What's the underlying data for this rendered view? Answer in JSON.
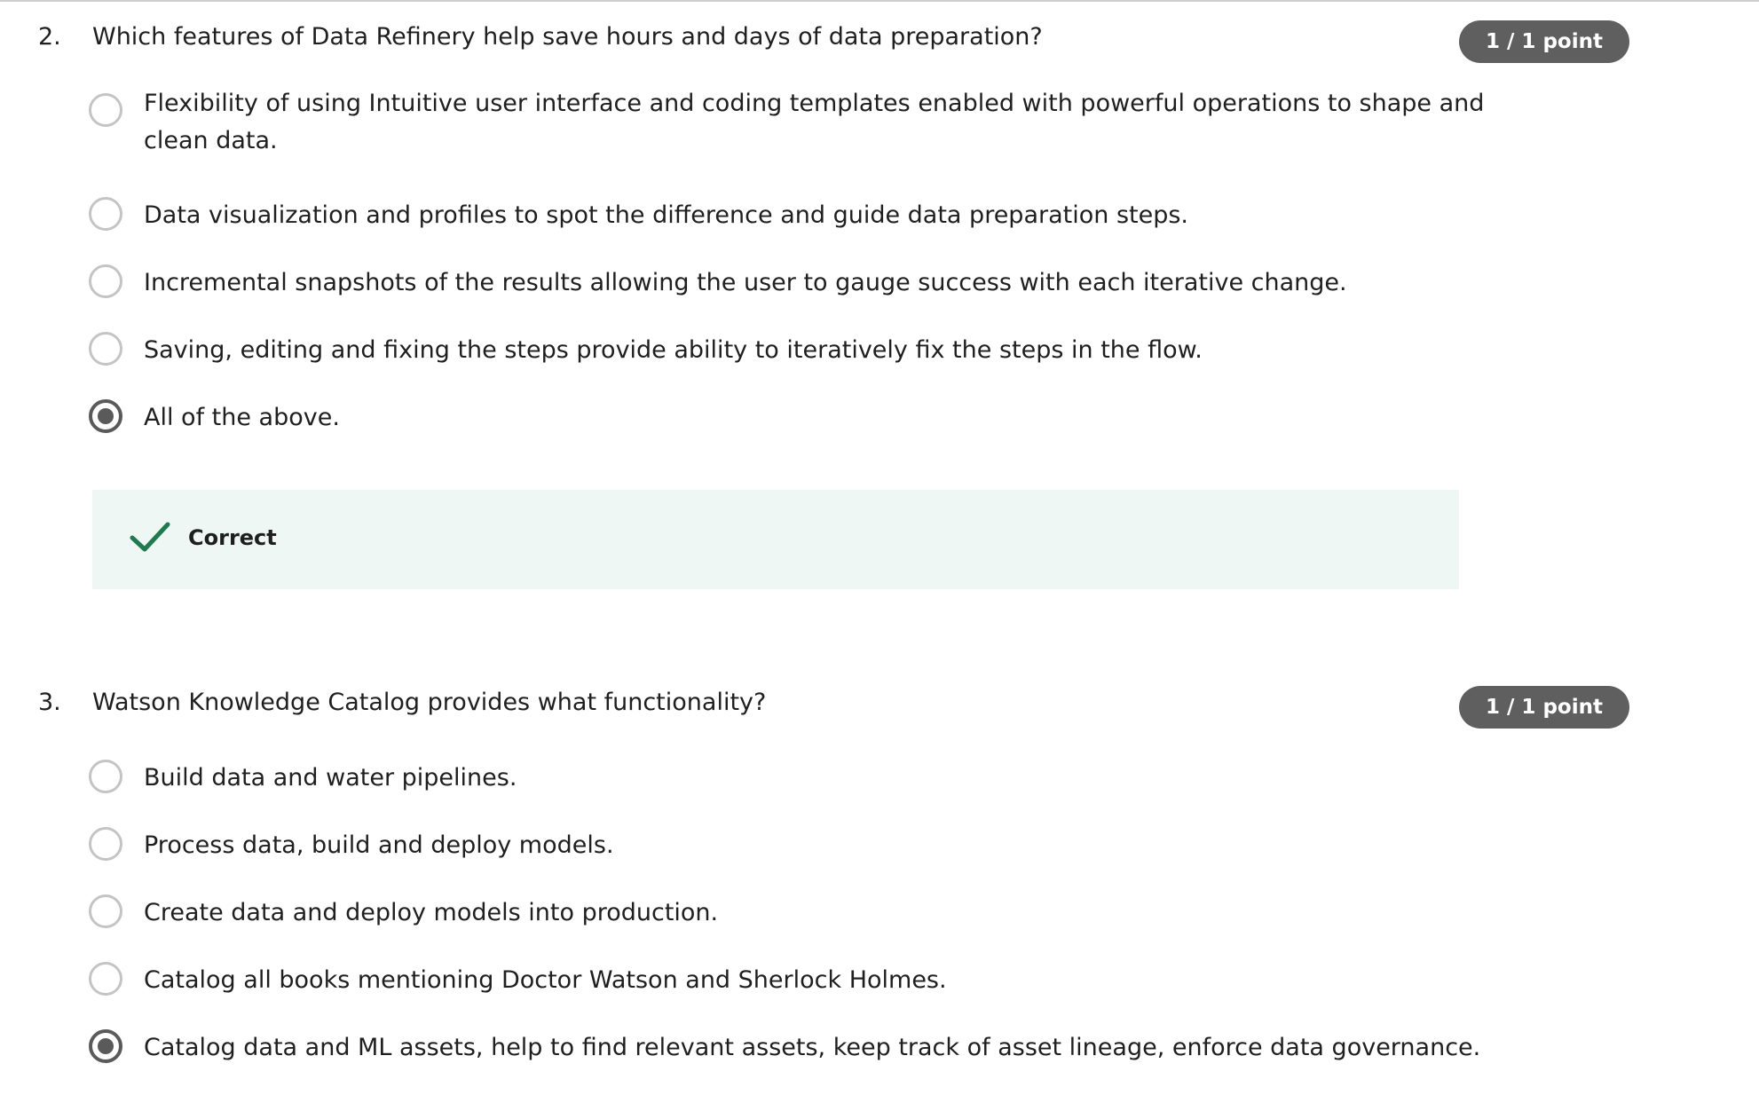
{
  "questions": [
    {
      "number": "2.",
      "text": "Which features of Data Refinery help save hours and days of data preparation?",
      "points": "1 / 1 point",
      "options": [
        {
          "label": "Flexibility of using Intuitive user interface and coding templates enabled with powerful operations to shape and clean data.",
          "selected": false
        },
        {
          "label": "Data visualization and profiles to spot the difference and guide data preparation steps.",
          "selected": false
        },
        {
          "label": "Incremental snapshots of the results allowing the user to gauge success with each iterative change.",
          "selected": false
        },
        {
          "label": "Saving, editing and fixing the steps provide ability to iteratively fix the steps in the flow.",
          "selected": false
        },
        {
          "label": "All of the above.",
          "selected": true
        }
      ],
      "feedback": {
        "label": "Correct",
        "icon": "check-icon",
        "color": "#1e7a4f"
      }
    },
    {
      "number": "3.",
      "text": "Watson Knowledge Catalog provides what functionality?",
      "points": "1 / 1 point",
      "options": [
        {
          "label": "Build data and water pipelines.",
          "selected": false
        },
        {
          "label": "Process data, build and deploy models.",
          "selected": false
        },
        {
          "label": "Create data and deploy models into production.",
          "selected": false
        },
        {
          "label": "Catalog all books mentioning Doctor Watson and Sherlock Holmes.",
          "selected": false
        },
        {
          "label": "Catalog data and ML assets, help to find relevant assets, keep track of asset lineage, enforce data governance.",
          "selected": true
        }
      ]
    }
  ],
  "colors": {
    "badge_bg": "#5f5f5f",
    "feedback_bg": "#eef7f3",
    "radio_border": "#c4c4c4",
    "radio_selected": "#5a5a5a",
    "success": "#1e7a4f"
  }
}
